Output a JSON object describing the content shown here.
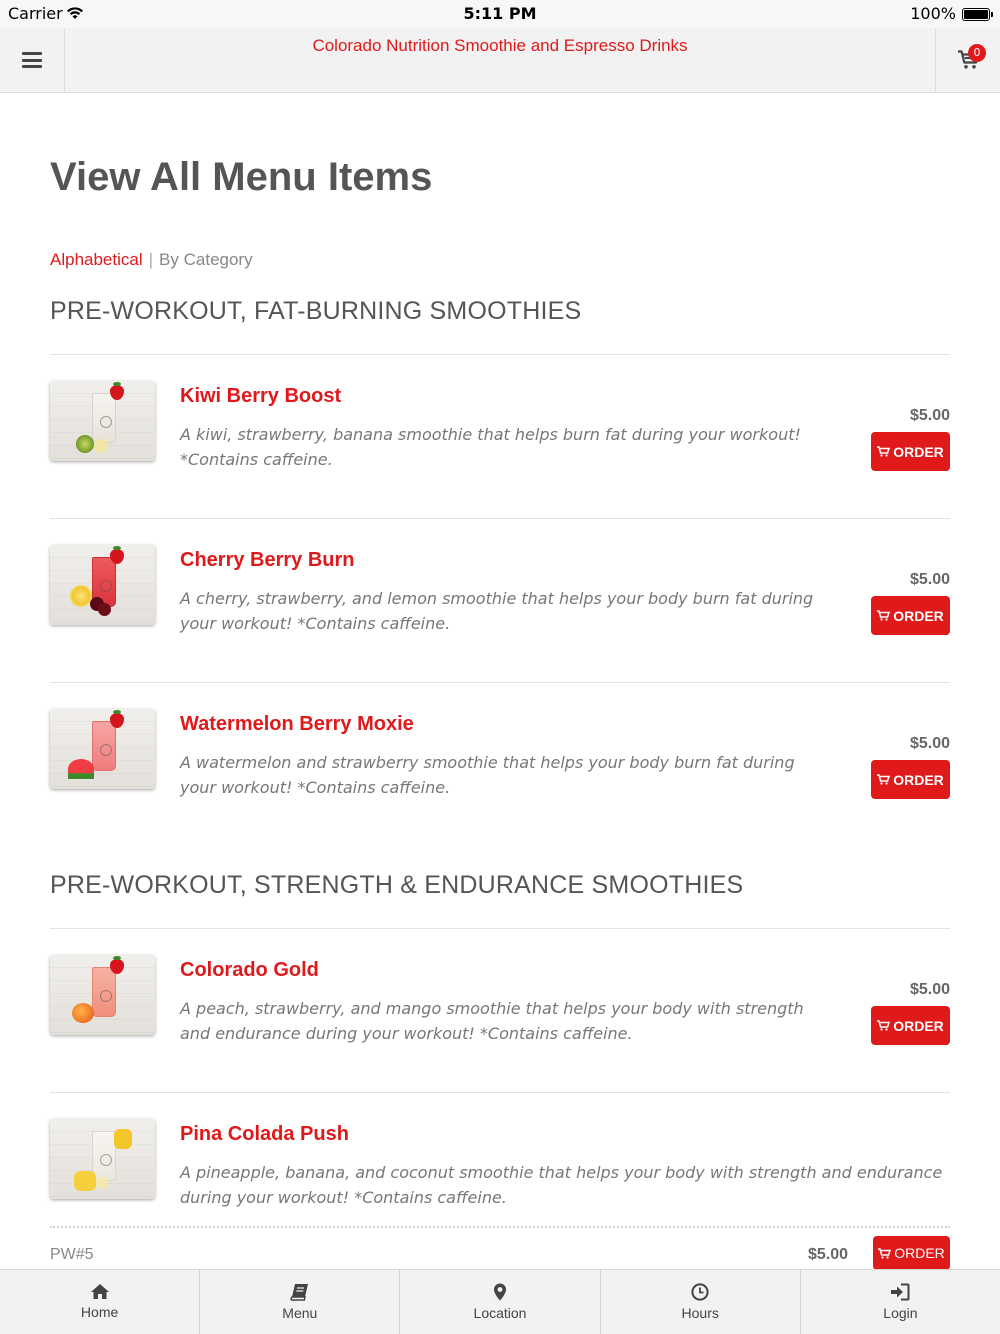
{
  "status_bar": {
    "carrier": "Carrier",
    "time": "5:11 PM",
    "battery": "100%"
  },
  "header": {
    "title": "Colorado Nutrition Smoothie and Espresso Drinks",
    "cart_count": "0"
  },
  "page": {
    "title": "View All Menu Items",
    "sort_active": "Alphabetical",
    "sort_separator": "|",
    "sort_other": "By Category"
  },
  "colors": {
    "accent": "#e0191b",
    "text": "#555555",
    "muted": "#777777"
  },
  "categories": [
    {
      "title": "PRE-WORKOUT, FAT-BURNING SMOOTHIES",
      "items": [
        {
          "name": "Kiwi Berry Boost",
          "description": "A kiwi, strawberry, banana smoothie that helps burn fat during your workout! *Contains caffeine.",
          "price": "$5.00",
          "order_label": "ORDER"
        },
        {
          "name": "Cherry Berry Burn",
          "description": "A cherry, strawberry, and lemon smoothie that helps your body burn fat during your workout! *Contains caffeine.",
          "price": "$5.00",
          "order_label": "ORDER"
        },
        {
          "name": "Watermelon Berry Moxie",
          "description": "A watermelon and strawberry smoothie that helps your body burn fat during your workout! *Contains caffeine.",
          "price": "$5.00",
          "order_label": "ORDER"
        }
      ]
    },
    {
      "title": "PRE-WORKOUT, STRENGTH & ENDURANCE SMOOTHIES",
      "items": [
        {
          "name": "Colorado Gold",
          "description": "A peach, strawberry, and mango smoothie that helps your body with strength and endurance during your workout! *Contains caffeine.",
          "price": "$5.00",
          "order_label": "ORDER"
        },
        {
          "name": "Pina Colada Push",
          "description": "A pineapple, banana, and coconut smoothie that helps your body with strength and endurance during your workout! *Contains caffeine.",
          "code": "PW#5",
          "price": "$5.00",
          "order_label": "ORDER"
        }
      ]
    }
  ],
  "tab_bar": [
    {
      "label": "Home",
      "icon": "home-icon"
    },
    {
      "label": "Menu",
      "icon": "book-icon"
    },
    {
      "label": "Location",
      "icon": "map-pin-icon"
    },
    {
      "label": "Hours",
      "icon": "clock-icon"
    },
    {
      "label": "Login",
      "icon": "login-icon"
    }
  ]
}
